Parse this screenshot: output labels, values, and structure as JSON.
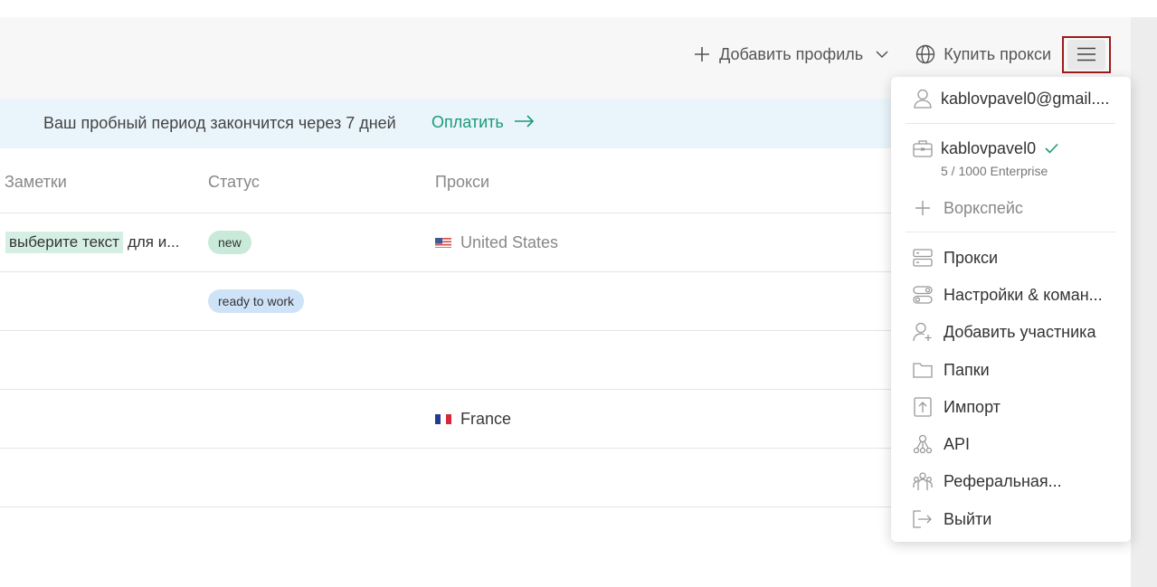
{
  "header": {
    "add_profile_label": "Добавить профиль",
    "buy_proxy_label": "Купить прокси",
    "menu_icon": "hamburger-icon"
  },
  "banner": {
    "text": "Ваш пробный период закончится через 7 дней",
    "link_label": "Оплатить"
  },
  "table": {
    "columns": [
      "Заметки",
      "Статус",
      "Прокси"
    ],
    "rows": [
      {
        "note_highlight": "выберите текст",
        "note_rest": "для и...",
        "status": "new",
        "proxy_country": "United States",
        "proxy_flag": "us"
      },
      {
        "note_highlight": "",
        "note_rest": "",
        "status": "ready to work",
        "proxy_country": "",
        "proxy_flag": ""
      },
      {
        "note_highlight": "",
        "note_rest": "",
        "status": "",
        "proxy_country": "",
        "proxy_flag": ""
      },
      {
        "note_highlight": "",
        "note_rest": "",
        "status": "",
        "proxy_country": "France",
        "proxy_flag": "fr"
      },
      {
        "note_highlight": "",
        "note_rest": "",
        "status": "",
        "proxy_country": "",
        "proxy_flag": ""
      }
    ]
  },
  "menu": {
    "email": "kablovpavel0@gmail....",
    "workspace_name": "kablovpavel0",
    "workspace_plan": "5 / 1000 Enterprise",
    "add_workspace": "Воркспейс",
    "items": [
      {
        "label": "Прокси",
        "icon": "server-icon"
      },
      {
        "label": "Настройки & коман...",
        "icon": "settings-toggle-icon"
      },
      {
        "label": "Добавить участника",
        "icon": "add-user-icon"
      },
      {
        "label": "Папки",
        "icon": "folder-icon"
      },
      {
        "label": "Импорт",
        "icon": "import-icon"
      },
      {
        "label": "API",
        "icon": "api-icon"
      },
      {
        "label": "Реферальная...",
        "icon": "referral-icon"
      },
      {
        "label": "Выйти",
        "icon": "logout-icon"
      }
    ]
  },
  "colors": {
    "accent_green": "#1a9a78",
    "badge_new": "#c9ead9",
    "badge_ready": "#cfe3f8",
    "banner_bg": "#eaf5fb",
    "highlight_border": "#9b1c1c"
  }
}
